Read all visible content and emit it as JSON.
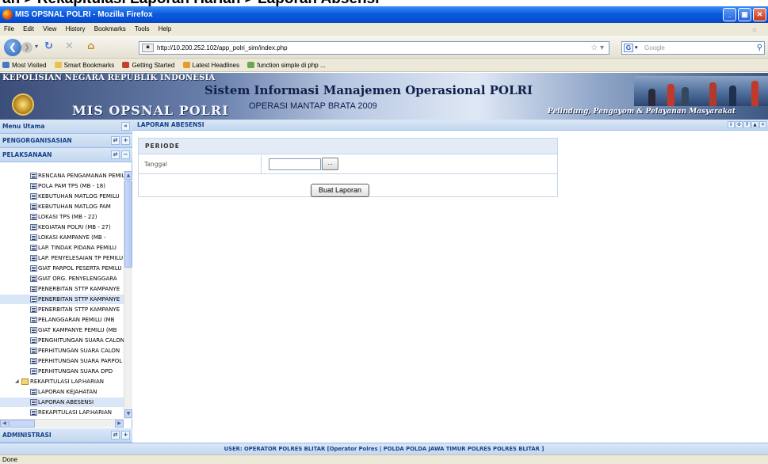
{
  "caption": "an > Rekapitulasi Laporan Harian > Laporan Absensi",
  "window": {
    "title": "MIS OPSNAL POLRI - Mozilla Firefox"
  },
  "menubar": [
    "File",
    "Edit",
    "View",
    "History",
    "Bookmarks",
    "Tools",
    "Help"
  ],
  "navbar": {
    "url": "http://10.200.252.102/app_polri_sim/index.php",
    "search_placeholder": "Google"
  },
  "bookmarks": [
    {
      "label": "Most Visited",
      "color": "#4a78c8"
    },
    {
      "label": "Smart Bookmarks",
      "color": "#e8c24a"
    },
    {
      "label": "Getting Started",
      "color": "#c8402a"
    },
    {
      "label": "Latest Headlines",
      "color": "#e89a2a"
    },
    {
      "label": "function simple di php ...",
      "color": "#6aa84f"
    }
  ],
  "banner": {
    "org": "KEPOLISIAN NEGARA REPUBLIK INDONESIA",
    "app": "MIS OPSNAL POLRI",
    "system": "Sistem Informasi Manajemen Operasional POLRI",
    "operation": "OPERASI MANTAP BRATA 2009",
    "motto": "Pelindung, Pengayom & Pelayanan Masyarakat"
  },
  "sidebar": {
    "title": "Menu Utama",
    "sections": [
      "PENGORGANISASIAN",
      "PELAKSANAAN",
      "ADMINISTRASI"
    ],
    "items": [
      "RENCANA PENGAMANAN PEMILU",
      "POLA PAM TPS (MB - 18)",
      "KEBUTUHAN MATLOG PEMILU",
      "KEBUTUHAN MATLOG PAM",
      "LOKASI TPS (MB - 22)",
      "KEGIATAN POLRI (MB - 27)",
      "LOKASI KAMPANYE (MB -",
      "LAP. TINDAK PIDANA PEMILU",
      "LAP. PENYELESAIAN TP PEMILU",
      "GIAT PARPOL PESERTA PEMILU",
      "GIAT ORG. PENYELENGGARA",
      "PENERBITAN STTP KAMPANYE",
      "PENERBITAN STTP KAMPANYE",
      "PENERBITAN STTP KAMPANYE",
      "PELANGGARAN PEMILU (MB",
      "GIAT KAMPANYE PEMILU (MB",
      "PENGHITUNGAN SUARA CALON",
      "PERHITUNGAN SUARA CALON",
      "PERHITUNGAN SUARA PARPOL",
      "PERHITUNGAN SUARA DPD"
    ],
    "group": {
      "label": "REKAPITULASI LAP.HARIAN",
      "children": [
        "LAPORAN KEJAHATAN",
        "LAPORAN ABESENSI",
        "REKAPITULASI LAP.HARIAN"
      ]
    }
  },
  "main": {
    "title": "LAPORAN ABESENSI",
    "form": {
      "section": "PERIODE",
      "date_label": "Tanggal",
      "date_value": "",
      "picker_label": "...",
      "submit_label": "Buat Laporan"
    }
  },
  "footer": "USER: OPERATOR POLRES BLITAR [Operator Polres | POLDA POLDA JAWA TIMUR POLRES POLRES BLITAR ]",
  "status": "Done"
}
